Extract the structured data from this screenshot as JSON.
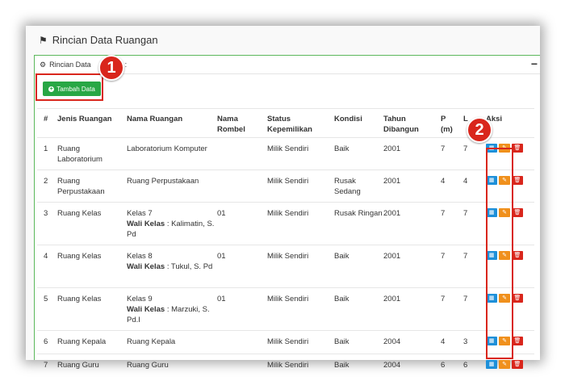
{
  "page": {
    "title": "Rincian Data Ruangan"
  },
  "panel": {
    "title": "Rincian Data",
    "title_suffix": ":",
    "collapse_label": "−"
  },
  "buttons": {
    "add_label": "Tambah Data"
  },
  "callouts": {
    "one": "1",
    "two": "2"
  },
  "table": {
    "headers": {
      "no": "#",
      "jenis": "Jenis Ruangan",
      "nama": "Nama Ruangan",
      "rombel_1": "Nama",
      "rombel_2": "Rombel",
      "status_1": "Status",
      "status_2": "Kepemilikan",
      "kondisi": "Kondisi",
      "tahun_1": "Tahun",
      "tahun_2": "Dibangun",
      "p_1": "P",
      "p_2": "(m)",
      "l": "L",
      "aksi": "Aksi"
    },
    "wali_label": "Wali Kelas",
    "rows": [
      {
        "no": "1",
        "jenis": "Ruang Laboratorium",
        "nama": "Laboratorium Komputer",
        "wali": "",
        "rombel": "",
        "status": "Milik Sendiri",
        "kondisi": "Baik",
        "tahun": "2001",
        "p": "7",
        "l": "7"
      },
      {
        "no": "2",
        "jenis": "Ruang Perpustakaan",
        "nama": "Ruang Perpustakaan",
        "wali": "",
        "rombel": "",
        "status": "Milik Sendiri",
        "kondisi": "Rusak Sedang",
        "tahun": "2001",
        "p": "4",
        "l": "4"
      },
      {
        "no": "3",
        "jenis": "Ruang Kelas",
        "nama": "Kelas 7",
        "wali": ": Kalimatin, S. Pd",
        "rombel": "01",
        "status": "Milik Sendiri",
        "kondisi": "Rusak Ringan",
        "tahun": "2001",
        "p": "7",
        "l": "7"
      },
      {
        "no": "4",
        "jenis": "Ruang Kelas",
        "nama": "Kelas 8",
        "wali": ": Tukul, S. Pd",
        "rombel": "01",
        "status": "Milik Sendiri",
        "kondisi": "Baik",
        "tahun": "2001",
        "p": "7",
        "l": "7"
      },
      {
        "no": "5",
        "jenis": "Ruang Kelas",
        "nama": "Kelas 9",
        "wali": ": Marzuki, S. Pd.I",
        "rombel": "01",
        "status": "Milik Sendiri",
        "kondisi": "Baik",
        "tahun": "2001",
        "p": "7",
        "l": "7"
      },
      {
        "no": "6",
        "jenis": "Ruang Kepala",
        "nama": "Ruang Kepala",
        "wali": "",
        "rombel": "",
        "status": "Milik Sendiri",
        "kondisi": "Baik",
        "tahun": "2004",
        "p": "4",
        "l": "3"
      },
      {
        "no": "7",
        "jenis": "Ruang Guru",
        "nama": "Ruang Guru",
        "wali": "",
        "rombel": "",
        "status": "Milik Sendiri",
        "kondisi": "Baik",
        "tahun": "2004",
        "p": "6",
        "l": "6"
      }
    ],
    "actions": {
      "view_icon": "book-icon",
      "edit_icon": "edit-icon",
      "delete_icon": "trash-icon"
    }
  },
  "colors": {
    "primary": "#28a745",
    "callout": "#d9261c",
    "view": "#1e90d9",
    "edit": "#f0901c",
    "delete": "#d9261c"
  }
}
